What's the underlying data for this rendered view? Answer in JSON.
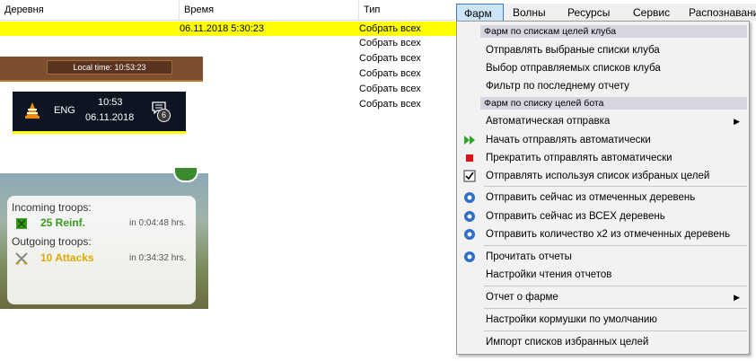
{
  "table": {
    "columns": [
      "Деревня",
      "Время",
      "Тип"
    ],
    "rows": [
      {
        "village": "",
        "time": "06.11.2018 5:30:23",
        "type": "Собрать всех"
      },
      {
        "village": "",
        "time": "",
        "type": "Собрать всех"
      },
      {
        "village": "",
        "time": "",
        "type": "Собрать всех"
      },
      {
        "village": "",
        "time": "",
        "type": "Собрать всех"
      },
      {
        "village": "",
        "time": "",
        "type": "Собрать всех"
      },
      {
        "village": "",
        "time": "",
        "type": "Собрать всех"
      }
    ]
  },
  "game_bar": {
    "local_time": "Local time:  10:53:23"
  },
  "taskbar": {
    "lang": "ENG",
    "time": "10:53",
    "date": "06.11.2018",
    "notifications": "6"
  },
  "troops": {
    "incoming_label": "Incoming troops:",
    "incoming_amount": "25 Reinf.",
    "incoming_time": "in 0:04:48 hrs.",
    "outgoing_label": "Outgoing troops:",
    "outgoing_amount": "10 Attacks",
    "outgoing_time": "in 0:34:32 hrs."
  },
  "menubar": {
    "items": [
      "Фарм",
      "Волны",
      "Ресурсы",
      "Сервис",
      "Распознавани"
    ]
  },
  "dropdown": {
    "header1": "Фарм по спискам целей клуба",
    "item1": "Отправлять выбраные списки клуба",
    "item2": "Выбор отправляемых списков клуба",
    "item3": "Фильтр по последнему отчету",
    "header2": "Фарм по списку целей бота",
    "item4": "Автоматическая отправка",
    "item5": "Начать отправлять автоматически",
    "item6": "Прекратить отправлять автоматически",
    "item7": "Отправлять используя список избраных целей",
    "item8": "Отправить сейчас из отмеченных деревень",
    "item9": "Отправить сейчас из ВСЕХ деревень",
    "item10": "Отправить количество x2 из отмеченных деревень",
    "item11": "Прочитать отчеты",
    "item12": "Настройки чтения отчетов",
    "item13": "Отчет о фарме",
    "item14": "Настройки кормушки по умолчанию",
    "item15": "Импорт списков избранных целей"
  },
  "colors": {
    "selection": "#ffff00",
    "menu_active": "#cce4f7",
    "incoming": "#3a9a1e",
    "outgoing": "#e0a800"
  }
}
